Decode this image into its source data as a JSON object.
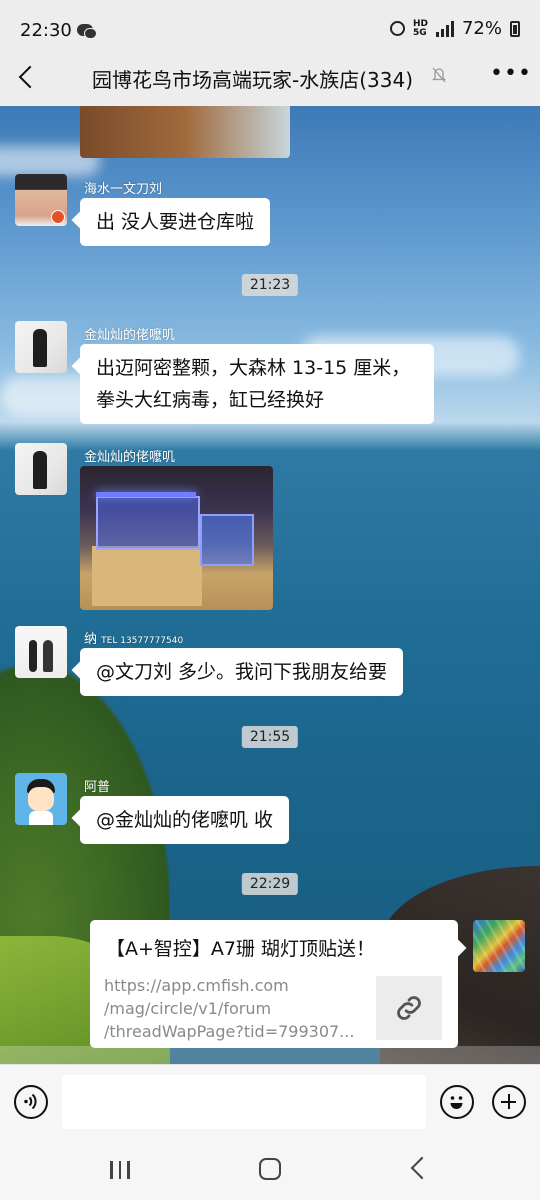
{
  "status_bar": {
    "time": "22:30",
    "network_label": "HD",
    "network_type": "5G",
    "battery_percent": "72%",
    "icons": [
      "wechat-icon",
      "alarm-icon",
      "signal-icon",
      "battery-icon"
    ]
  },
  "header": {
    "title": "园博花鸟市场高端玩家-水族店(334)",
    "muted": true
  },
  "messages": [
    {
      "id": "m1",
      "sender": "海水一文刀刘",
      "type": "text",
      "text": "出 没人要进仓库啦"
    },
    {
      "id": "t1",
      "type": "time",
      "text": "21:23"
    },
    {
      "id": "m2",
      "sender": "金灿灿的佬嚒叽",
      "type": "text",
      "lines": [
        "出迈阿密整颗，大森林 13-15 厘米，",
        "拳头大红病毒，缸已经换好"
      ]
    },
    {
      "id": "m3",
      "sender": "金灿灿的佬嚒叽",
      "type": "image"
    },
    {
      "id": "m4",
      "sender": "纳",
      "sender_suffix": "TEL 13577777540",
      "type": "text",
      "text": "@文刀刘  多少。我问下我朋友给要"
    },
    {
      "id": "t2",
      "type": "time",
      "text": "21:55"
    },
    {
      "id": "m5",
      "sender": "阿普",
      "type": "text",
      "text": "@金灿灿的佬嚒叽  收"
    },
    {
      "id": "t3",
      "type": "time",
      "text": "22:29"
    },
    {
      "id": "m6",
      "type": "link",
      "from_self": true,
      "title": "【A+智控】A7珊 瑚灯顶贴送！",
      "url_lines": [
        "https://app.cmfish.com",
        "/mag/circle/v1/forum",
        "/threadWapPage?tid=799307..."
      ]
    }
  ],
  "input_bar": {
    "placeholder": "",
    "icons": [
      "voice-icon",
      "emoji-icon",
      "plus-icon"
    ]
  }
}
